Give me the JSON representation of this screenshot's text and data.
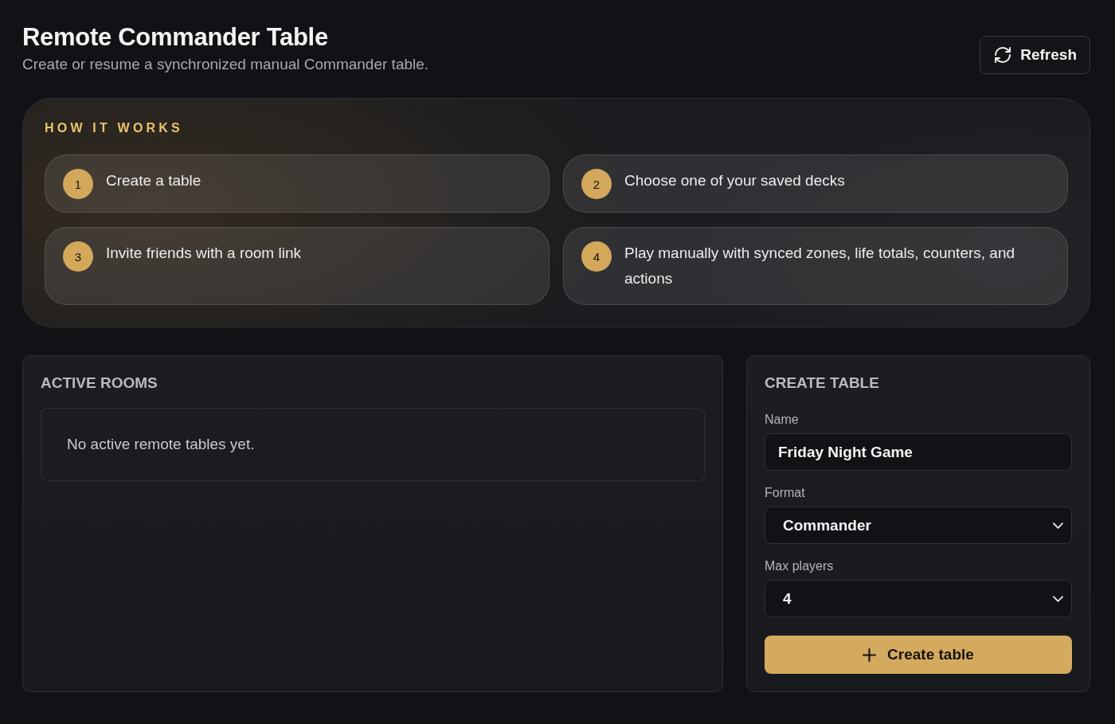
{
  "header": {
    "title": "Remote Commander Table",
    "subtitle": "Create or resume a synchronized manual Commander table.",
    "refresh_button": "Refresh"
  },
  "how_it_works": {
    "heading": "HOW IT WORKS",
    "steps": [
      {
        "number": "1",
        "text": "Create a table"
      },
      {
        "number": "2",
        "text": "Choose one of your saved decks"
      },
      {
        "number": "3",
        "text": "Invite friends with a room link"
      },
      {
        "number": "4",
        "text": "Play manually with synced zones, life totals, counters, and actions"
      }
    ]
  },
  "active_rooms": {
    "heading": "ACTIVE ROOMS",
    "empty_message": "No active remote tables yet."
  },
  "create_table": {
    "heading": "CREATE TABLE",
    "fields": [
      {
        "kind": "text",
        "label": "Name",
        "value": "Friday Night Game"
      },
      {
        "kind": "select",
        "label": "Format",
        "value": "Commander"
      },
      {
        "kind": "select",
        "label": "Max players",
        "value": "4"
      }
    ],
    "submit_button": "Create table"
  }
}
